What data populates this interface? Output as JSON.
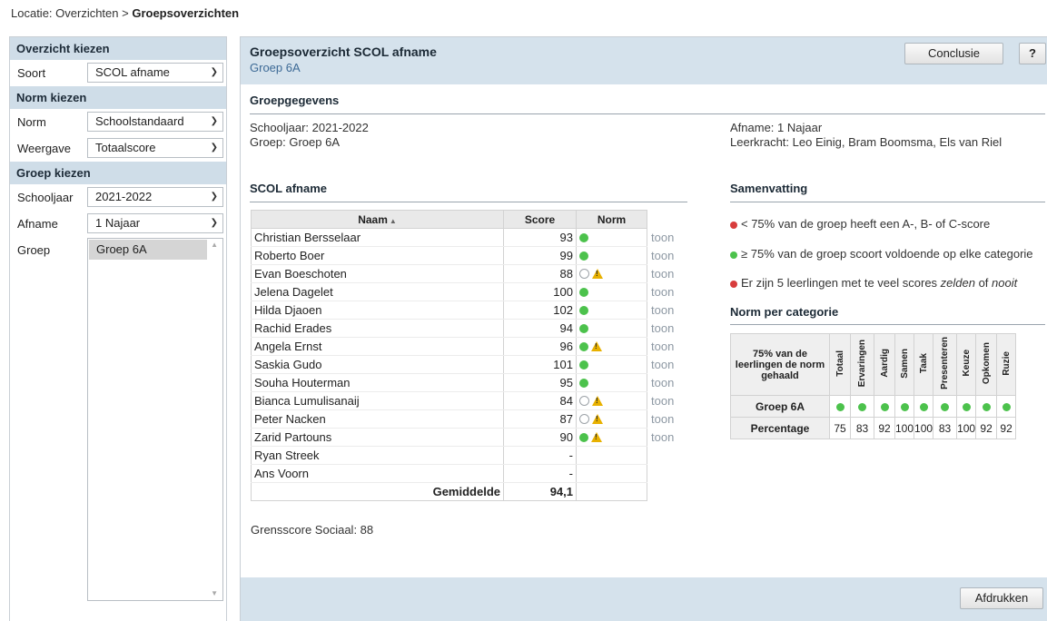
{
  "breadcrumb": {
    "prefix": "Locatie: Overzichten > ",
    "current": "Groepsoverzichten"
  },
  "sidebar": {
    "overzicht": {
      "header": "Overzicht kiezen",
      "soort_label": "Soort",
      "soort_value": "SCOL afname"
    },
    "norm": {
      "header": "Norm kiezen",
      "norm_label": "Norm",
      "norm_value": "Schoolstandaard",
      "weergave_label": "Weergave",
      "weergave_value": "Totaalscore"
    },
    "groep": {
      "header": "Groep kiezen",
      "schooljaar_label": "Schooljaar",
      "schooljaar_value": "2021-2022",
      "afname_label": "Afname",
      "afname_value": "1 Najaar",
      "groep_label": "Groep",
      "groep_items": [
        "Groep 6A"
      ]
    }
  },
  "main": {
    "title": "Groepsoverzicht SCOL afname",
    "subtitle": "Groep 6A",
    "conclusie_label": "Conclusie",
    "help_label": "?",
    "print_label": "Afdrukken"
  },
  "groepgegevens": {
    "title": "Groepgegevens",
    "schooljaar": "Schooljaar: 2021-2022",
    "groep": "Groep: Groep 6A",
    "afname": "Afname: 1 Najaar",
    "leerkracht": "Leerkracht: Leo Einig, Bram Boomsma, Els van Riel"
  },
  "scol": {
    "title": "SCOL afname",
    "col_naam": "Naam",
    "col_score": "Score",
    "col_norm": "Norm",
    "toon_label": "toon",
    "students": [
      {
        "name": "Christian Bersselaar",
        "score": "93",
        "norm": "green",
        "warn": false
      },
      {
        "name": "Roberto Boer",
        "score": "99",
        "norm": "green",
        "warn": false
      },
      {
        "name": "Evan Boeschoten",
        "score": "88",
        "norm": "empty",
        "warn": true
      },
      {
        "name": "Jelena Dagelet",
        "score": "100",
        "norm": "green",
        "warn": false
      },
      {
        "name": "Hilda Djaoen",
        "score": "102",
        "norm": "green",
        "warn": false
      },
      {
        "name": "Rachid Erades",
        "score": "94",
        "norm": "green",
        "warn": false
      },
      {
        "name": "Angela Ernst",
        "score": "96",
        "norm": "green",
        "warn": true
      },
      {
        "name": "Saskia Gudo",
        "score": "101",
        "norm": "green",
        "warn": false
      },
      {
        "name": "Souha Houterman",
        "score": "95",
        "norm": "green",
        "warn": false
      },
      {
        "name": "Bianca Lumulisanaij",
        "score": "84",
        "norm": "empty",
        "warn": true
      },
      {
        "name": "Peter Nacken",
        "score": "87",
        "norm": "empty",
        "warn": true
      },
      {
        "name": "Zarid Partouns",
        "score": "90",
        "norm": "green",
        "warn": true
      },
      {
        "name": "Ryan Streek",
        "score": "-",
        "norm": "none",
        "warn": false
      },
      {
        "name": "Ans Voorn",
        "score": "-",
        "norm": "none",
        "warn": false
      }
    ],
    "gemiddelde_label": "Gemiddelde",
    "gemiddelde_value": "94,1",
    "grensscore": "Grensscore Sociaal: 88"
  },
  "samenvatting": {
    "title": "Samenvatting",
    "line1": "< 75% van de groep heeft een A-, B- of C-score",
    "line2": "≥ 75% van de groep scoort voldoende op elke categorie",
    "line3_prefix": "Er zijn 5 leerlingen met te veel scores ",
    "line3_zelden": "zelden",
    "line3_of": " of ",
    "line3_nooit": "nooit"
  },
  "norm_per_categorie": {
    "title": "Norm per categorie",
    "corner_label": "75% van de leerlingen de norm gehaald",
    "categories": [
      "Totaal",
      "Ervaringen",
      "Aardig",
      "Samen",
      "Taak",
      "Presenteren",
      "Keuze",
      "Opkomen",
      "Ruzie"
    ],
    "group_label": "Groep 6A",
    "group_status": [
      "green",
      "green",
      "green",
      "green",
      "green",
      "green",
      "green",
      "green",
      "green"
    ],
    "percentage_label": "Percentage",
    "percentages": [
      "75",
      "83",
      "92",
      "100",
      "100",
      "83",
      "100",
      "92",
      "92"
    ]
  },
  "colors": {
    "header_bg": "#d5e2ec",
    "accent_text": "#3d6a96",
    "green": "#4cc24c",
    "red": "#d83c3c",
    "warning": "#e8b100"
  }
}
